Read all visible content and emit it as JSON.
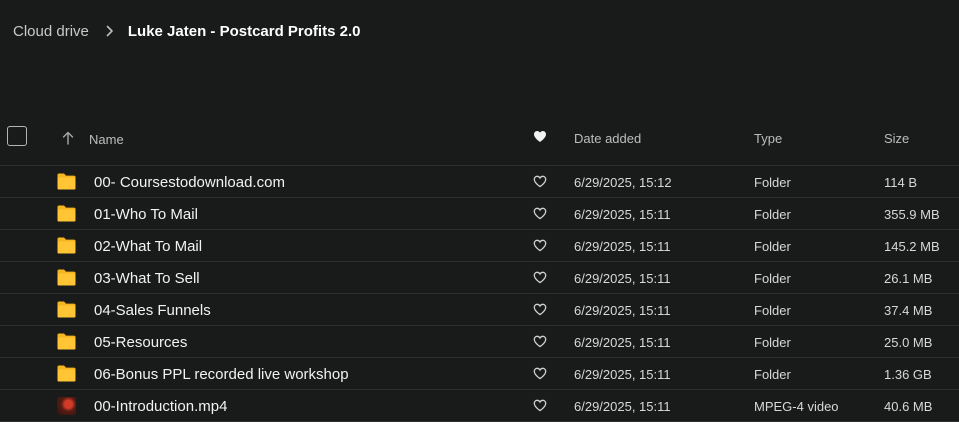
{
  "breadcrumb": {
    "root": "Cloud drive",
    "current": "Luke Jaten - Postcard Profits 2.0"
  },
  "table": {
    "columns": {
      "name": "Name",
      "date": "Date added",
      "type": "Type",
      "size": "Size"
    },
    "rows": [
      {
        "name": "00- Coursestodownload.com",
        "date": "6/29/2025, 15:12",
        "type": "Folder",
        "size": "114 B",
        "icon": "folder-icon"
      },
      {
        "name": "01-Who To Mail",
        "date": "6/29/2025, 15:11",
        "type": "Folder",
        "size": "355.9 MB",
        "icon": "folder-icon"
      },
      {
        "name": "02-What To Mail",
        "date": "6/29/2025, 15:11",
        "type": "Folder",
        "size": "145.2 MB",
        "icon": "folder-icon"
      },
      {
        "name": "03-What To Sell",
        "date": "6/29/2025, 15:11",
        "type": "Folder",
        "size": "26.1 MB",
        "icon": "folder-icon"
      },
      {
        "name": "04-Sales Funnels",
        "date": "6/29/2025, 15:11",
        "type": "Folder",
        "size": "37.4 MB",
        "icon": "folder-icon"
      },
      {
        "name": "05-Resources",
        "date": "6/29/2025, 15:11",
        "type": "Folder",
        "size": "25.0 MB",
        "icon": "folder-icon"
      },
      {
        "name": "06-Bonus PPL recorded live workshop",
        "date": "6/29/2025, 15:11",
        "type": "Folder",
        "size": "1.36 GB",
        "icon": "folder-icon"
      },
      {
        "name": "00-Introduction.mp4",
        "date": "6/29/2025, 15:11",
        "type": "MPEG-4 video",
        "size": "40.6 MB",
        "icon": "video-thumbnail"
      }
    ]
  },
  "colors": {
    "background": "#191a1a",
    "folder": "#f5b521",
    "divider": "#2e2f30",
    "text": "#f2f2f2",
    "muted": "#bdbdbd"
  }
}
